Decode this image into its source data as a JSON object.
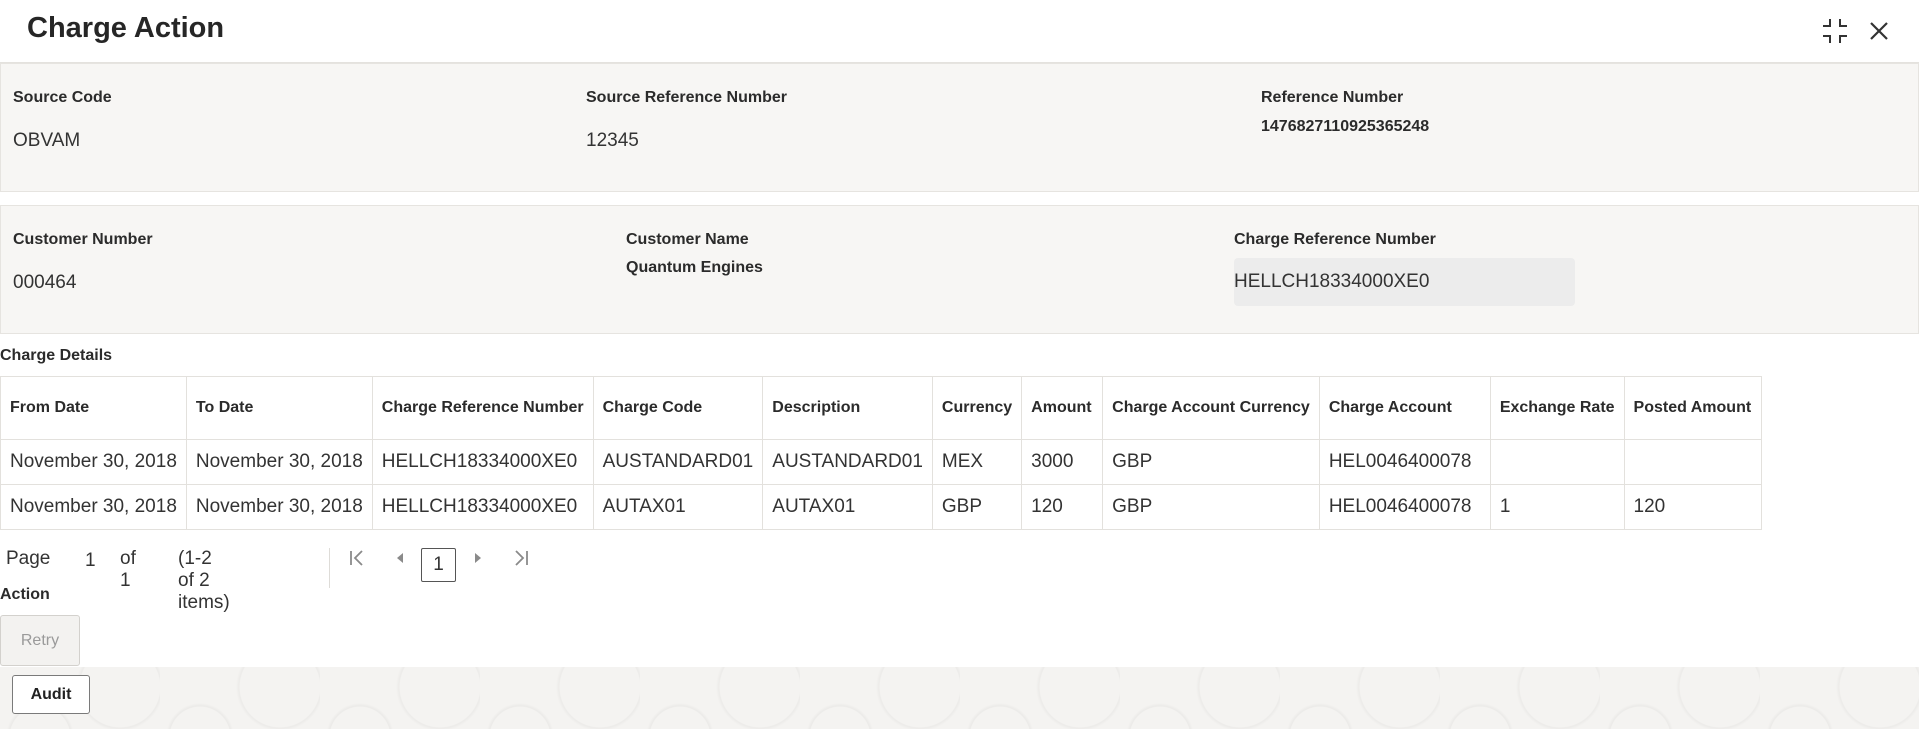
{
  "header": {
    "title": "Charge Action",
    "collapse_icon": "collapse-icon",
    "close_icon": "close-icon"
  },
  "source_panel": {
    "source_code_label": "Source Code",
    "source_code_value": "OBVAM",
    "source_ref_label": "Source Reference Number",
    "source_ref_value": "12345",
    "reference_label": "Reference Number",
    "reference_value": "1476827110925365248"
  },
  "customer_panel": {
    "customer_number_label": "Customer Number",
    "customer_number_value": "000464",
    "customer_name_label": "Customer Name",
    "customer_name_value": "Quantum Engines",
    "charge_ref_label": "Charge Reference Number",
    "charge_ref_value": "HELLCH18334000XE0"
  },
  "charge_details": {
    "section_label": "Charge Details",
    "columns": [
      "From Date",
      "To Date",
      "Charge Reference Number",
      "Charge Code",
      "Description",
      "Currency",
      "Amount",
      "Charge Account Currency",
      "Charge Account",
      "Exchange Rate",
      "Posted Amount"
    ],
    "rows": [
      [
        "November 30, 2018",
        "November 30, 2018",
        "HELLCH18334000XE0",
        "AUSTANDARD01",
        "AUSTANDARD01",
        "MEX",
        "3000",
        "GBP",
        "HEL0046400078",
        "",
        ""
      ],
      [
        "November 30, 2018",
        "November 30, 2018",
        "HELLCH18334000XE0",
        "AUTAX01",
        "AUTAX01",
        "GBP",
        "120",
        "GBP",
        "HEL0046400078",
        "1",
        "120"
      ]
    ]
  },
  "pager": {
    "page_label": "Page",
    "page_value": "1",
    "of_label": "of 1",
    "items_label": "(1-2 of 2 items)",
    "current_page": "1"
  },
  "action": {
    "section_label": "Action",
    "retry_label": "Retry",
    "audit_label": "Audit"
  }
}
